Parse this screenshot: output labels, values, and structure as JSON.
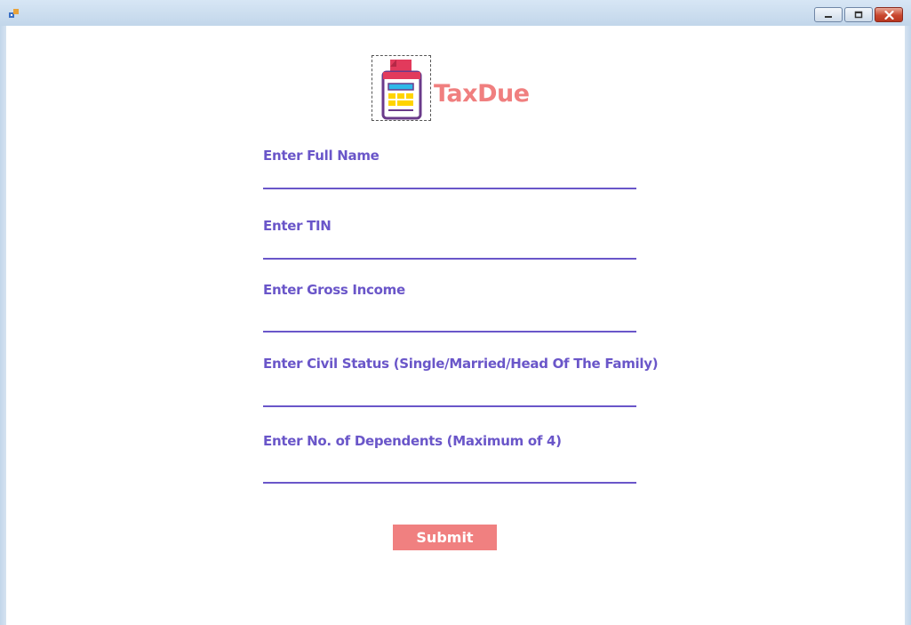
{
  "app": {
    "name": "TaxDue"
  },
  "window": {
    "controls": {
      "minimize_icon": "minimize-icon",
      "maximize_icon": "maximize-icon",
      "close_icon": "close-icon"
    }
  },
  "logo": {
    "icon": "calculator-receipt-icon"
  },
  "form": {
    "fields": [
      {
        "label": "Enter Full Name",
        "value": ""
      },
      {
        "label": "Enter TIN",
        "value": ""
      },
      {
        "label": "Enter Gross Income",
        "value": ""
      },
      {
        "label": "Enter Civil Status (Single/Married/Head Of The Family)",
        "value": ""
      },
      {
        "label": "Enter No. of Dependents (Maximum of 4)",
        "value": ""
      }
    ],
    "submit_label": "Submit"
  },
  "colors": {
    "brand": "#f07f7f",
    "label": "#6a56c9",
    "button": "#f08080"
  }
}
